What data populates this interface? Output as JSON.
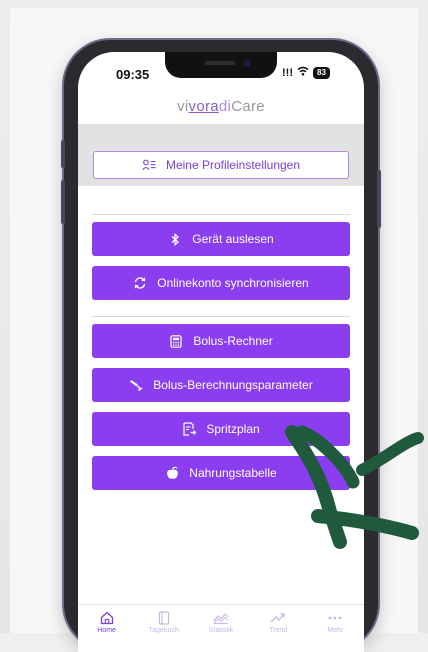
{
  "status": {
    "time": "09:35",
    "signal": "!!!",
    "battery": "83"
  },
  "logo": {
    "part1": "vi",
    "part2": "vora",
    "part3": "di",
    "part4": "Care"
  },
  "profile": {
    "label": "Meine Profileinstellungen",
    "icon": "profile-list-icon"
  },
  "actions": [
    {
      "label": "Gerät auslesen",
      "icon": "bluetooth-icon"
    },
    {
      "label": "Onlinekonto synchronisieren",
      "icon": "sync-icon"
    }
  ],
  "tools": [
    {
      "label": "Bolus-Rechner",
      "icon": "calculator-icon"
    },
    {
      "label": "Bolus-Berechnungsparameter",
      "icon": "syringe-icon"
    },
    {
      "label": "Spritzplan",
      "icon": "plan-icon"
    },
    {
      "label": "Nahrungstabelle",
      "icon": "apple-icon"
    }
  ],
  "tabs": [
    {
      "label": "Home",
      "icon": "home-icon",
      "active": true
    },
    {
      "label": "Tagebuch",
      "icon": "diary-icon",
      "active": false
    },
    {
      "label": "Statistik",
      "icon": "statistics-icon",
      "active": false
    },
    {
      "label": "Trend",
      "icon": "trend-icon",
      "active": false
    },
    {
      "label": "Mehr",
      "icon": "more-icon",
      "active": false
    }
  ],
  "colors": {
    "accent": "#8a3ef0",
    "accent_text": "#7a3fd6",
    "gesture": "#1f5a3c"
  }
}
